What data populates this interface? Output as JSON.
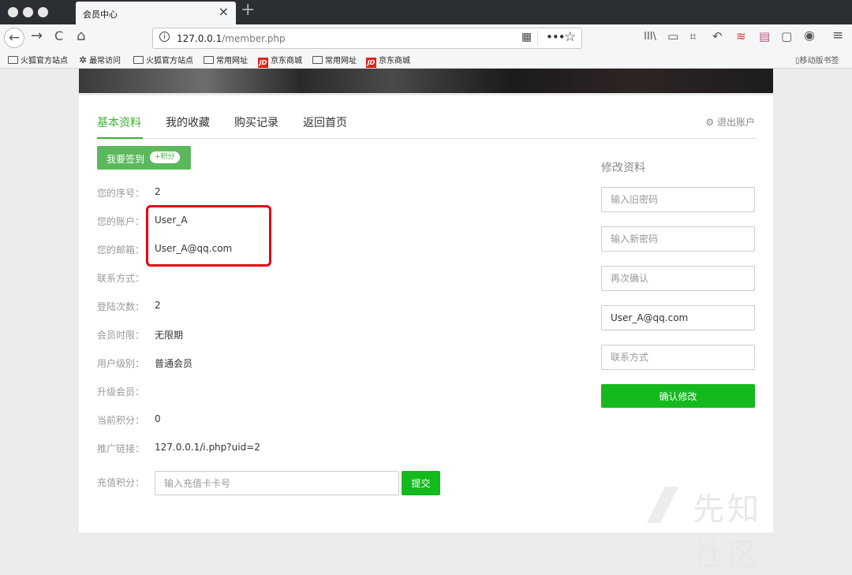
{
  "browser": {
    "tab_title": "会员中心",
    "tab_close": "×",
    "new_tab": "+",
    "url_host": "127.0.0.1",
    "url_path": "/member.php",
    "info_icon": "i",
    "page_actions": "•••",
    "bookmark_star": "☆",
    "back": "←",
    "forward": "→",
    "reload": "C",
    "home": "⌂",
    "library": "III\\",
    "menu": "≡"
  },
  "bookmarks": [
    {
      "label": "火狐官方站点",
      "icon": "folder-icon"
    },
    {
      "label": "最常访问",
      "icon": "gear-icon"
    },
    {
      "label": "火狐官方站点",
      "icon": "folder-icon"
    },
    {
      "label": "常用网址",
      "icon": "folder-icon"
    },
    {
      "label": "京东商城",
      "icon": "jd-icon"
    },
    {
      "label": "常用网址",
      "icon": "folder-icon"
    },
    {
      "label": "京东商城",
      "icon": "jd-icon"
    }
  ],
  "jd_mark": "JD",
  "mobile_bookmarks": "移动版书签",
  "tabs": {
    "basic": "基本资料",
    "favorites": "我的收藏",
    "purchases": "购买记录",
    "home": "返回首页",
    "logout": "退出账户",
    "logout_icon": "⚙"
  },
  "signin": {
    "label": "我要签到",
    "badge": "+积分"
  },
  "profile": [
    {
      "key": "您的序号：",
      "value": "2"
    },
    {
      "key": "您的账户：",
      "value": "User_A"
    },
    {
      "key": "您的邮箱：",
      "value": "User_A@qq.com"
    },
    {
      "key": "联系方式：",
      "value": ""
    },
    {
      "key": "登陆次数：",
      "value": "2"
    },
    {
      "key": "会员时限：",
      "value": "无限期"
    },
    {
      "key": "用户级别：",
      "value": "普通会员"
    },
    {
      "key": "升级会员：",
      "value": ""
    },
    {
      "key": "当前积分：",
      "value": "0"
    },
    {
      "key": "推广链接：",
      "value": "127.0.0.1/i.php?uid=2"
    }
  ],
  "recharge": {
    "label": "充值积分：",
    "placeholder": "输入充值卡卡号",
    "submit": "提交"
  },
  "edit": {
    "title": "修改资料",
    "old_password_placeholder": "输入旧密码",
    "new_password_placeholder": "输入新密码",
    "confirm_placeholder": "再次确认",
    "email_value": "User_A@qq.com",
    "contact_placeholder": "联系方式",
    "confirm_button": "确认修改"
  },
  "watermark": "先知社区",
  "colors": {
    "accent": "#3cb035",
    "button": "#14b91e",
    "highlight": "#e60012"
  }
}
